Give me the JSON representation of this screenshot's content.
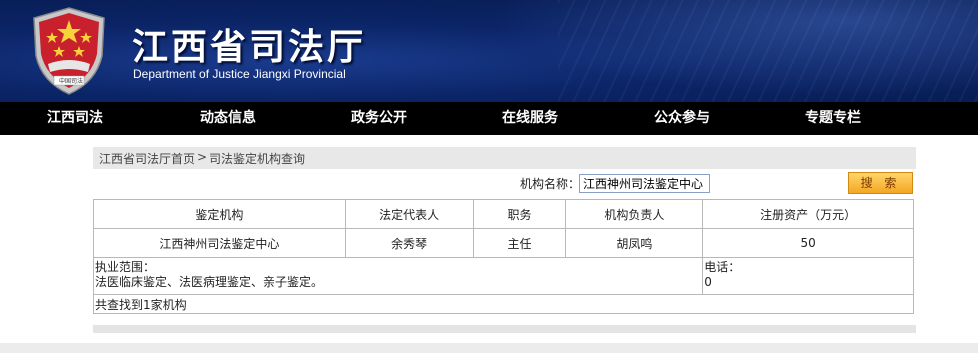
{
  "header": {
    "title_cn": "江西省司法厅",
    "title_en": "Department of Justice  Jiangxi Provincial",
    "emblem_caption": "中国司法"
  },
  "nav": {
    "items": [
      "江西司法",
      "动态信息",
      "政务公开",
      "在线服务",
      "公众参与",
      "专题专栏"
    ]
  },
  "breadcrumb": {
    "home": "江西省司法厅首页",
    "separator": ">",
    "current": "司法鉴定机构查询"
  },
  "search": {
    "label": "机构名称：",
    "value": "江西神州司法鉴定中心",
    "button_label": "搜 索"
  },
  "table": {
    "headers": [
      "鉴定机构",
      "法定代表人",
      "职务",
      "机构负责人",
      "注册资产（万元）"
    ],
    "row": [
      "江西神州司法鉴定中心",
      "余秀琴",
      "主任",
      "胡凤鸣",
      "50"
    ],
    "scope_label": "执业范围：",
    "scope_value": "法医临床鉴定、法医病理鉴定、亲子鉴定。",
    "phone_label": "电话：",
    "phone_value": "0",
    "summary": "共查找到1家机构"
  },
  "colors": {
    "banner": "#0b2466",
    "nav": "#000000",
    "button": "#f5a623"
  }
}
